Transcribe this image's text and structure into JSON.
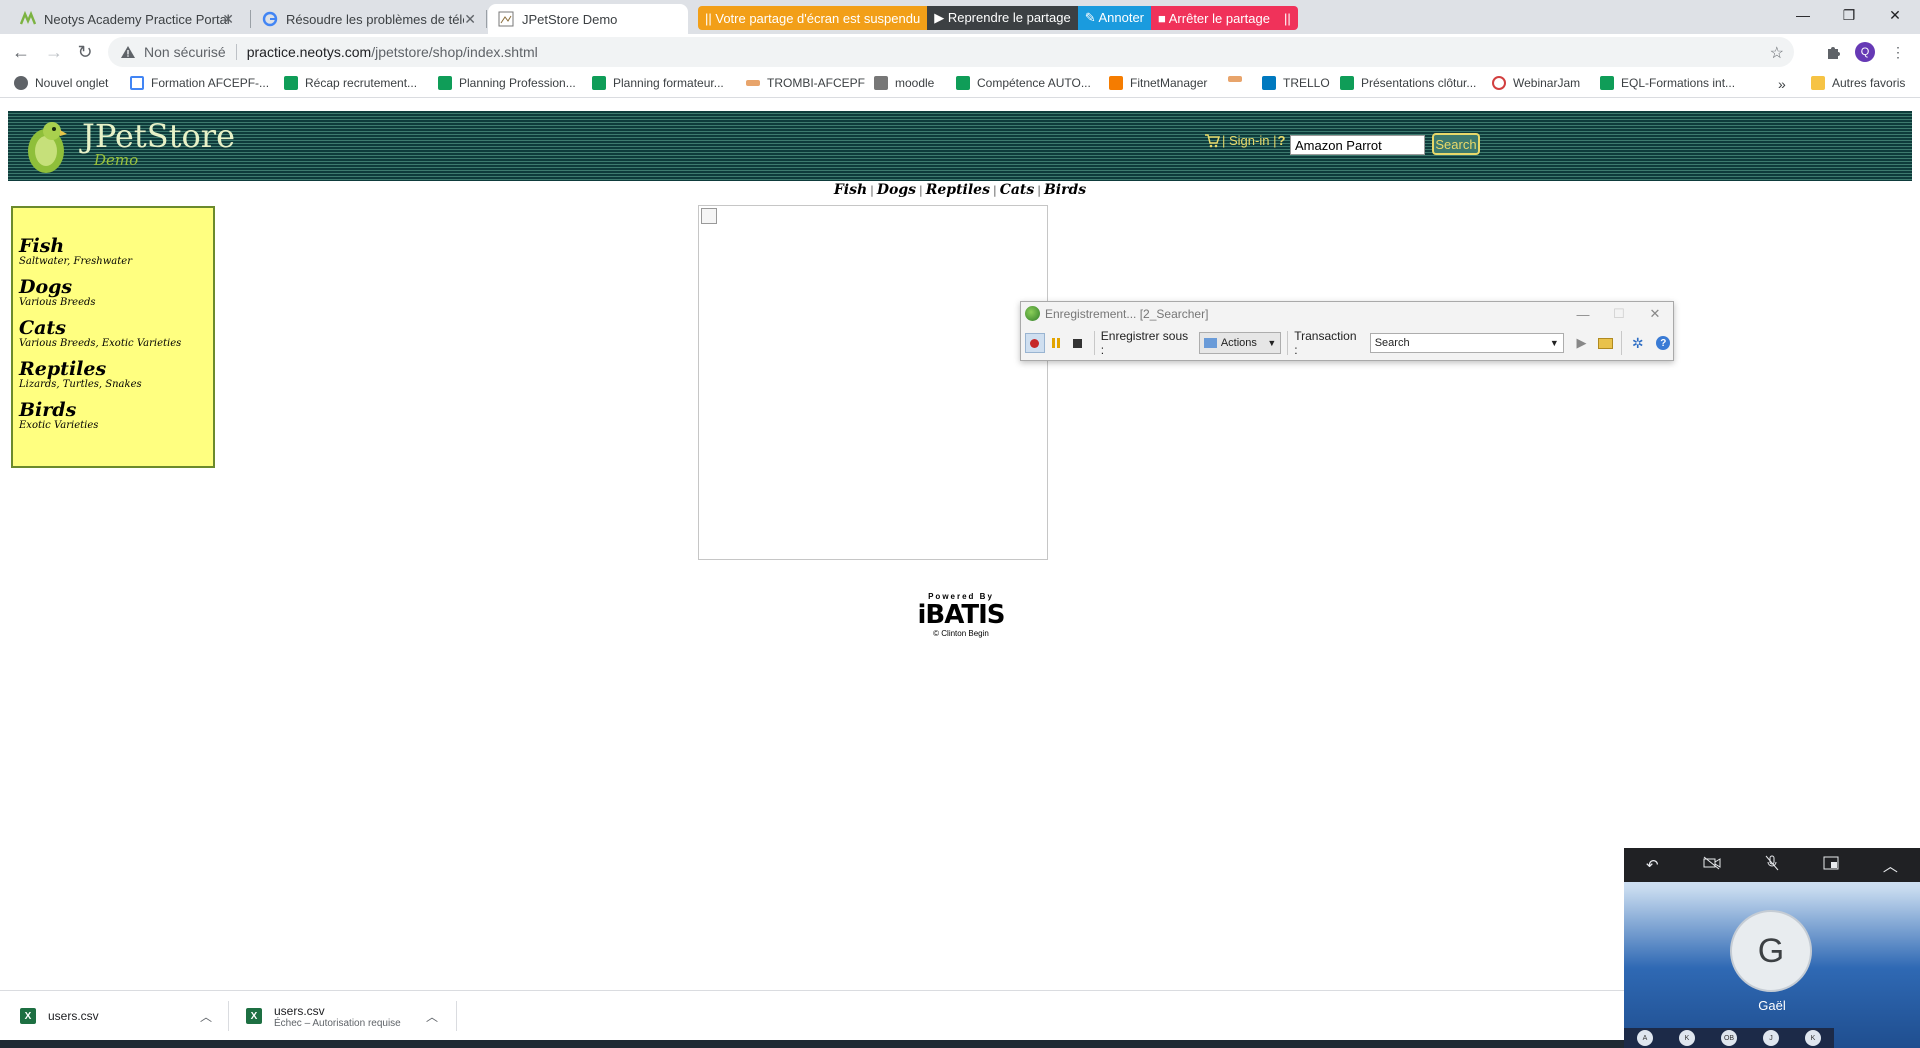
{
  "browser": {
    "tabs": [
      {
        "title": "Neotys Academy Practice Portal",
        "active": false
      },
      {
        "title": "Résoudre les problèmes de téléc",
        "active": false
      },
      {
        "title": "JPetStore Demo",
        "active": true
      }
    ],
    "close_glyph": "✕",
    "window_controls": {
      "minimize": "—",
      "restore": "❐",
      "close": "✕"
    }
  },
  "share_bar": {
    "status": "|| Votre partage d'écran est suspendu",
    "resume": "▶ Reprendre le partage",
    "annotate": "✎ Annoter",
    "stop": "■ Arrêter le partage",
    "handle": "||"
  },
  "address_bar": {
    "security_label": "Non sécurisé",
    "url_host": "practice.neotys.com",
    "url_path": "/jpetstore/shop/index.shtml",
    "profile_initial": "Q"
  },
  "bookmarks": [
    {
      "label": "Nouvel onglet",
      "icon": "globe-icon",
      "color": "#5f6368"
    },
    {
      "label": "Formation AFCEPF-...",
      "icon": "doc-icon",
      "color": "#4285f4"
    },
    {
      "label": "Récap recrutement...",
      "icon": "sheets-icon",
      "color": "#0f9d58"
    },
    {
      "label": "Planning Profession...",
      "icon": "sheets-icon",
      "color": "#0f9d58"
    },
    {
      "label": "Planning formateur...",
      "icon": "sheets-icon",
      "color": "#0f9d58"
    },
    {
      "label": "TROMBI-AFCEPF",
      "icon": "afcepf-icon",
      "color": "#e8a46b"
    },
    {
      "label": "moodle",
      "icon": "moodle-icon",
      "color": "#777777"
    },
    {
      "label": "Compétence AUTO...",
      "icon": "sheets-icon",
      "color": "#0f9d58"
    },
    {
      "label": "FitnetManager",
      "icon": "fitnet-icon",
      "color": "#f57c00"
    },
    {
      "label": "",
      "icon": "afcepf-icon",
      "color": "#e8a46b"
    },
    {
      "label": "TRELLO",
      "icon": "trello-icon",
      "color": "#0079bf"
    },
    {
      "label": "Présentations clôtur...",
      "icon": "sheets-icon",
      "color": "#0f9d58"
    },
    {
      "label": "WebinarJam",
      "icon": "webinarjam-icon",
      "color": "#d23f3f"
    },
    {
      "label": "EQL-Formations int...",
      "icon": "sheets-icon",
      "color": "#0f9d58"
    }
  ],
  "bookmarks_overflow": "»",
  "other_bookmarks": "Autres favoris",
  "jpetstore": {
    "logo_title": "JPetStore",
    "logo_subtitle": "Demo",
    "signin": "| Sign-in |",
    "help": "?",
    "search_value": "Amazon Parrot",
    "search_button": "Search",
    "quicklinks": [
      "Fish",
      "Dogs",
      "Reptiles",
      "Cats",
      "Birds"
    ],
    "categories": [
      {
        "name": "Fish",
        "desc": "Saltwater, Freshwater"
      },
      {
        "name": "Dogs",
        "desc": "Various Breeds"
      },
      {
        "name": "Cats",
        "desc": "Various Breeds, Exotic Varieties"
      },
      {
        "name": "Reptiles",
        "desc": "Lizards, Turtles, Snakes"
      },
      {
        "name": "Birds",
        "desc": "Exotic Varieties"
      }
    ],
    "ibatis_powered": "Powered By",
    "ibatis_logo": "iBATIS",
    "ibatis_credit": "© Clinton Begin"
  },
  "recorder": {
    "title": "Enregistrement... [2_Searcher]",
    "save_under_label": "Enregistrer sous :",
    "save_under_value": "Actions",
    "transaction_label": "Transaction :",
    "transaction_value": "Search"
  },
  "downloads": [
    {
      "filename": "users.csv",
      "status": ""
    },
    {
      "filename": "users.csv",
      "status": "Échec – Autorisation requise"
    }
  ],
  "meet_pip": {
    "initial": "G",
    "name": "Gaël",
    "participants": [
      "A",
      "K",
      "OB",
      "J",
      "K"
    ]
  },
  "colors": {
    "jp_header": "#0e3b3b",
    "jp_sidebar": "#ffff80",
    "share_status": "#f29f18",
    "share_annotate": "#1a9bde",
    "share_stop": "#f0325a"
  }
}
